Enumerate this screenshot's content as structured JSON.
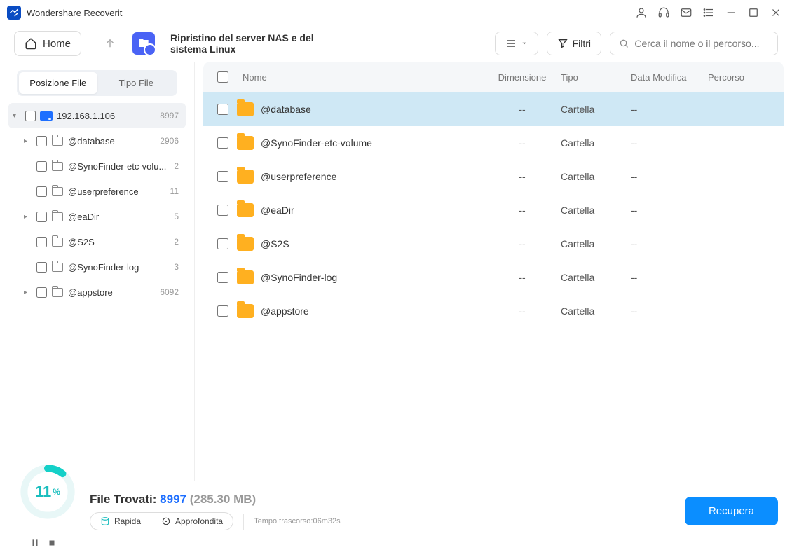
{
  "app": {
    "name": "Wondershare Recoverit"
  },
  "toolbar": {
    "home": "Home",
    "title": "Ripristino del server NAS e del sistema Linux",
    "filter": "Filtri",
    "search_placeholder": "Cerca il nome o il percorso..."
  },
  "sidebar": {
    "tabs": {
      "pos": "Posizione File",
      "type": "Tipo File"
    },
    "root": {
      "label": "192.168.1.106",
      "count": "8997"
    },
    "items": [
      {
        "label": "@database",
        "count": "2906",
        "expandable": true
      },
      {
        "label": "@SynoFinder-etc-volu...",
        "count": "2",
        "expandable": false
      },
      {
        "label": "@userpreference",
        "count": "11",
        "expandable": false
      },
      {
        "label": "@eaDir",
        "count": "5",
        "expandable": true
      },
      {
        "label": "@S2S",
        "count": "2",
        "expandable": false
      },
      {
        "label": "@SynoFinder-log",
        "count": "3",
        "expandable": false
      },
      {
        "label": "@appstore",
        "count": "6092",
        "expandable": true
      }
    ]
  },
  "table": {
    "headers": {
      "name": "Nome",
      "dim": "Dimensione",
      "type": "Tipo",
      "date": "Data Modifica",
      "path": "Percorso"
    },
    "rows": [
      {
        "name": "@database",
        "dim": "--",
        "type": "Cartella",
        "date": "--",
        "path": "",
        "selected": true
      },
      {
        "name": "@SynoFinder-etc-volume",
        "dim": "--",
        "type": "Cartella",
        "date": "--",
        "path": "",
        "selected": false
      },
      {
        "name": "@userpreference",
        "dim": "--",
        "type": "Cartella",
        "date": "--",
        "path": "",
        "selected": false
      },
      {
        "name": "@eaDir",
        "dim": "--",
        "type": "Cartella",
        "date": "--",
        "path": "",
        "selected": false
      },
      {
        "name": "@S2S",
        "dim": "--",
        "type": "Cartella",
        "date": "--",
        "path": "",
        "selected": false
      },
      {
        "name": "@SynoFinder-log",
        "dim": "--",
        "type": "Cartella",
        "date": "--",
        "path": "",
        "selected": false
      },
      {
        "name": "@appstore",
        "dim": "--",
        "type": "Cartella",
        "date": "--",
        "path": "",
        "selected": false
      }
    ]
  },
  "footer": {
    "progress_pct": 11,
    "found_label": "File Trovati:",
    "found_count": "8997",
    "found_size": "(285.30 MB)",
    "mode_fast": "Rapida",
    "mode_deep": "Approfondita",
    "elapsed": "Tempo trascorso:06m32s",
    "recover": "Recupera"
  }
}
